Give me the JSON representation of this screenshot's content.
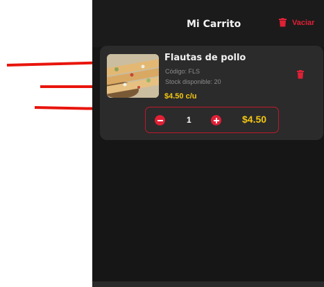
{
  "header": {
    "title": "Mi Carrito",
    "clear_label": "Vaciar",
    "trash_icon": "trash-icon"
  },
  "cart": {
    "items": [
      {
        "name": "Flautas de pollo",
        "code": "Código: FLS",
        "stock": "Stock disponible: 20",
        "unit_price": "$4.50 c/u",
        "quantity": "1",
        "total": "$4.50"
      }
    ]
  },
  "icons": {
    "decrease": "minus-circle-icon",
    "increase": "plus-circle-icon",
    "delete": "trash-icon"
  },
  "colors": {
    "accent": "#e02036",
    "price": "#f4c712",
    "background": "#161616",
    "card": "#2b2b2b",
    "annotation_arrow": "#e8150c"
  }
}
